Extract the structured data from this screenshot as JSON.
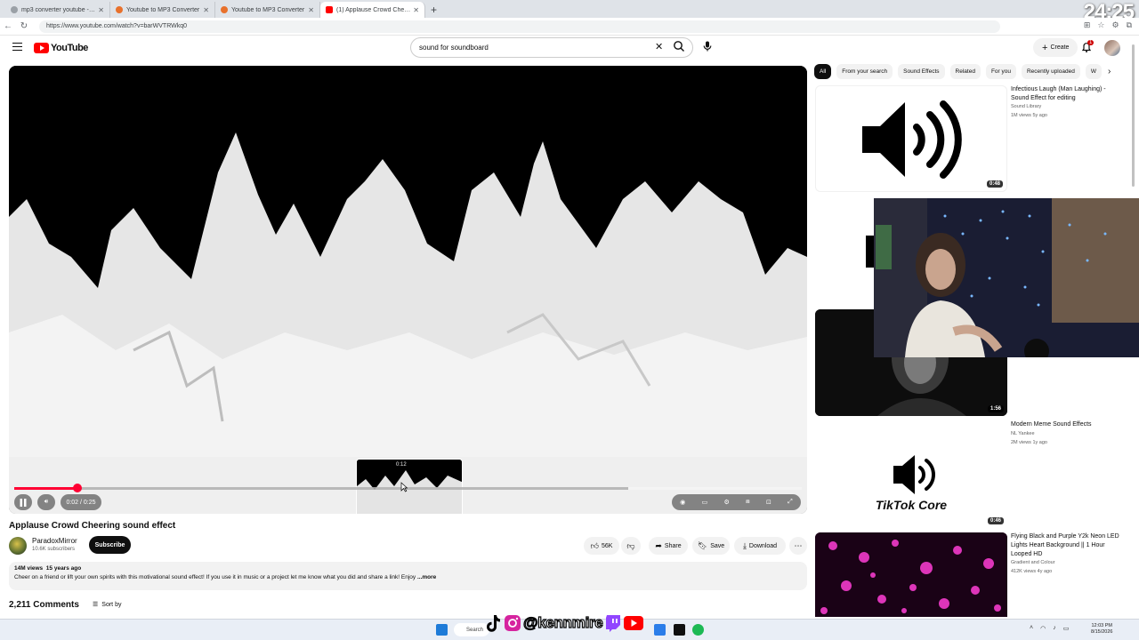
{
  "browser": {
    "tabs": [
      {
        "label": "mp3 converter youtube - Search",
        "icon_color": "#5f6368"
      },
      {
        "label": "Youtube to MP3 Converter",
        "icon_color": "#e8712c"
      },
      {
        "label": "Youtube to MP3 Converter",
        "icon_color": "#e8712c"
      },
      {
        "label": "(1) Applause Crowd Cheering",
        "icon_color": "#ff0000",
        "active": true
      }
    ],
    "new_tab": "+",
    "url": "https://www.youtube.com/watch?v=barWVTRWkq0",
    "clock_overlay": "24:25"
  },
  "youtube": {
    "logo_text": "YouTube",
    "search_query": "sound for soundboard",
    "create_label": "Create",
    "notifications_count": "1"
  },
  "player": {
    "current_time": "0:02",
    "duration": "0:25",
    "time_display": "0:02 / 0:25",
    "hover_preview_time": "0:12",
    "played_fraction": 0.08,
    "hover_fraction": 0.49,
    "loaded_fraction": 0.78
  },
  "video": {
    "title": "Applause Crowd Cheering sound effect",
    "channel": "ParadoxMirror",
    "subscribers": "10.6K subscribers",
    "subscribe_label": "Subscribe",
    "likes": "56K",
    "share_label": "Share",
    "save_label": "Save",
    "download_label": "Download",
    "views": "14M views",
    "age": "15 years ago",
    "description": "Cheer on a friend or lift your own spirits with this motivational sound effect!  If you use it in music or a project let me know what you did and share a link!  Enjoy",
    "more_label": "...more",
    "comments_count": "2,211 Comments",
    "sort_label": "Sort by"
  },
  "chips": [
    "All",
    "From your search",
    "Sound Effects",
    "Related",
    "For you",
    "Recently uploaded",
    "W"
  ],
  "recommendations": [
    {
      "title": "Infectious Laugh (Man Laughing) - Sound Effect for editing",
      "channel": "Sound Library",
      "stats": "1M views  5y ago",
      "duration": "0:48"
    },
    {
      "title": "",
      "channel": "",
      "stats": "",
      "duration": "1:56"
    },
    {
      "title": "Modern Meme Sound Effects",
      "channel": "NL Yankee",
      "stats": "2M views  1y ago",
      "duration": "0:46",
      "thumb_text": "TikTok Core"
    },
    {
      "title": "Flying Black and Purple Y2k Neon LED Lights Heart Background || 1 Hour Looped HD",
      "channel": "Gradient and Colour",
      "stats": "412K views  4y ago",
      "duration": ""
    }
  ],
  "overlay": {
    "handle": "@kennmire"
  },
  "taskbar": {
    "search_label": "Search",
    "time": "12:03 PM",
    "date": "8/15/2026"
  }
}
